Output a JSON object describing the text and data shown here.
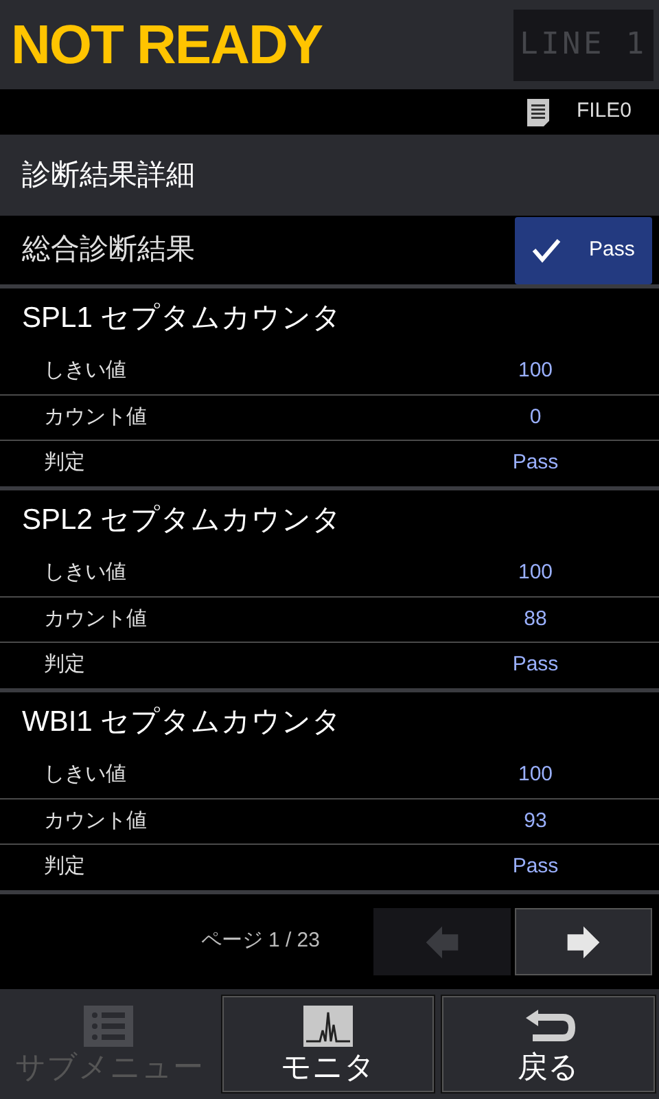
{
  "header": {
    "status": "NOT READY",
    "line": "LINE 1"
  },
  "file_bar": {
    "file": "FILE0"
  },
  "page_title": "診断結果詳細",
  "overall": {
    "label": "総合診断結果",
    "result": "Pass",
    "checked": true
  },
  "sections": [
    {
      "title": "SPL1 セプタムカウンタ",
      "rows": [
        {
          "label": "しきい値",
          "value": "100"
        },
        {
          "label": "カウント値",
          "value": "0"
        },
        {
          "label": "判定",
          "value": "Pass"
        }
      ]
    },
    {
      "title": "SPL2 セプタムカウンタ",
      "rows": [
        {
          "label": "しきい値",
          "value": "100"
        },
        {
          "label": "カウント値",
          "value": "88"
        },
        {
          "label": "判定",
          "value": "Pass"
        }
      ]
    },
    {
      "title": "WBI1 セプタムカウンタ",
      "rows": [
        {
          "label": "しきい値",
          "value": "100"
        },
        {
          "label": "カウント値",
          "value": "93"
        },
        {
          "label": "判定",
          "value": "Pass"
        }
      ]
    }
  ],
  "pager": {
    "text": "ページ 1 / 23",
    "prev_disabled": true,
    "next_disabled": false
  },
  "bottom_buttons": [
    {
      "kind": "submenu",
      "label": "サブメニュー",
      "disabled": true
    },
    {
      "kind": "monitor",
      "label": "モニタ",
      "disabled": false
    },
    {
      "kind": "back",
      "label": "戻る",
      "disabled": false
    }
  ]
}
